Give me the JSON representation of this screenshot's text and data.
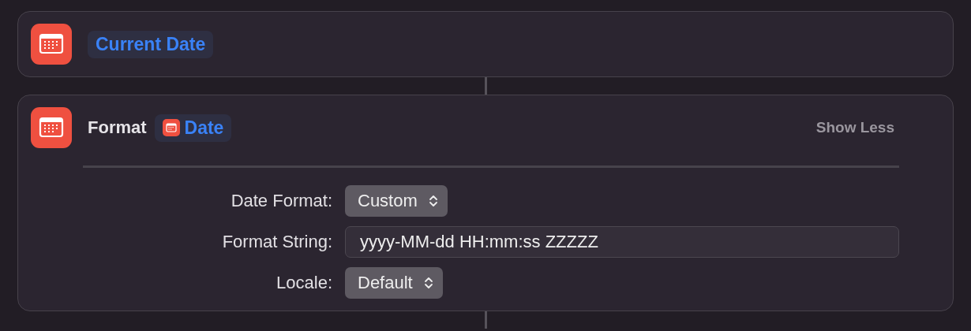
{
  "actions": [
    {
      "variable": "Current Date",
      "variable_icon": false
    },
    {
      "title": "Format",
      "variable": "Date",
      "variable_icon": true,
      "toggle": "Show Less",
      "params": [
        {
          "kind": "popup",
          "label": "Date Format:",
          "value": "Custom"
        },
        {
          "kind": "text",
          "label": "Format String:",
          "value": "yyyy-MM-dd HH:mm:ss ZZZZZ"
        },
        {
          "kind": "popup",
          "label": "Locale:",
          "value": "Default"
        }
      ]
    }
  ]
}
